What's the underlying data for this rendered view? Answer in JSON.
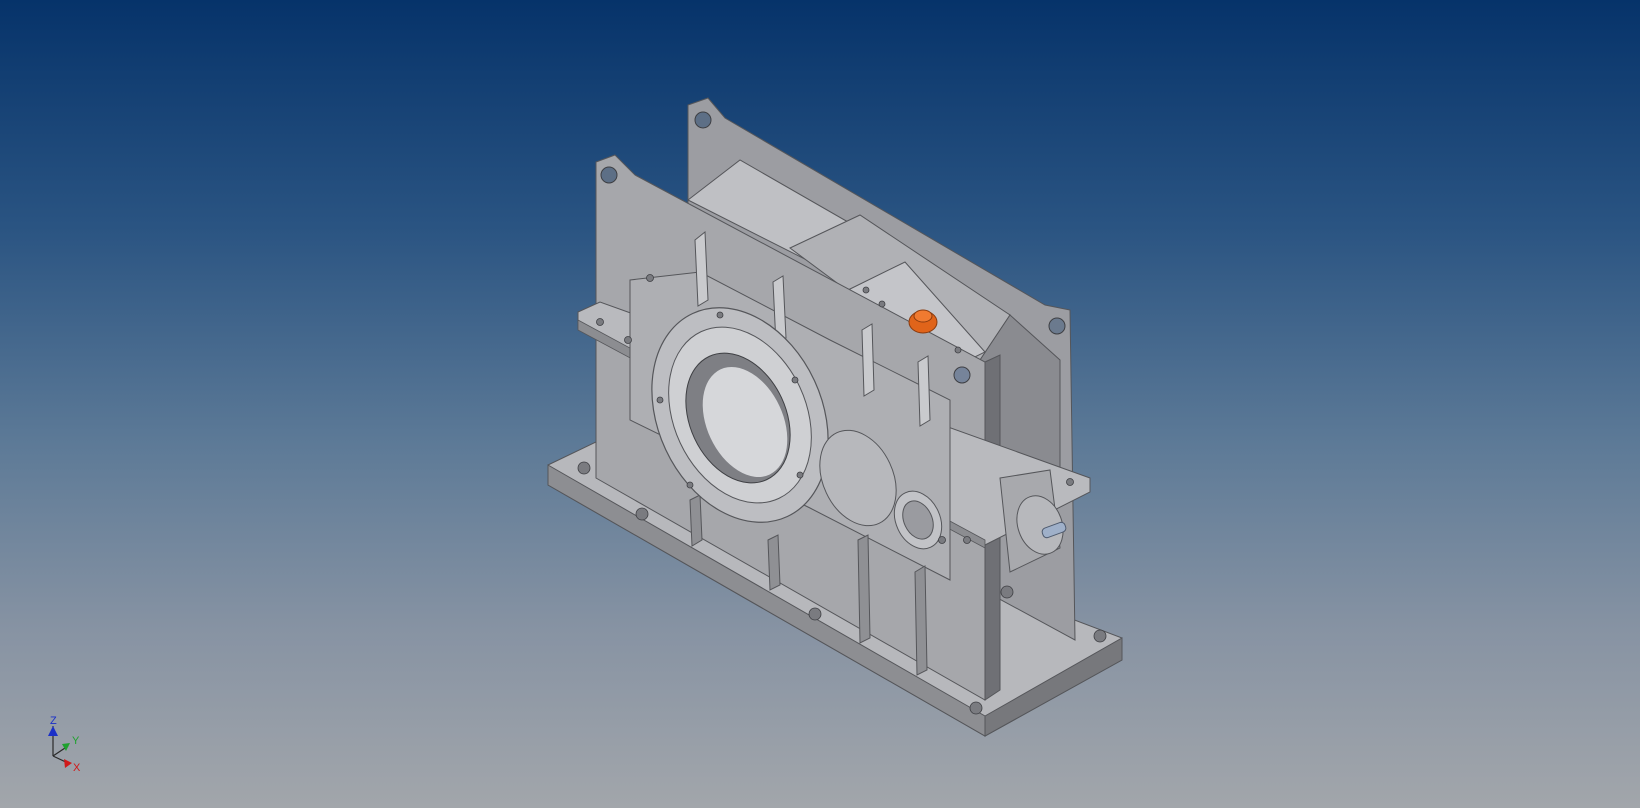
{
  "viewcube_triad": {
    "x_label": "X",
    "y_label": "Y",
    "z_label": "Z",
    "x_color": "#d01a1a",
    "y_color": "#1fa12e",
    "z_color": "#1a2fc8"
  },
  "model": {
    "name_icon": "gearbox-3d-model",
    "body_color": "#a4a5aa",
    "shadow_color": "#6e6f74",
    "highlight_color": "#c6c7cb",
    "plug_color": "#e0641a"
  }
}
